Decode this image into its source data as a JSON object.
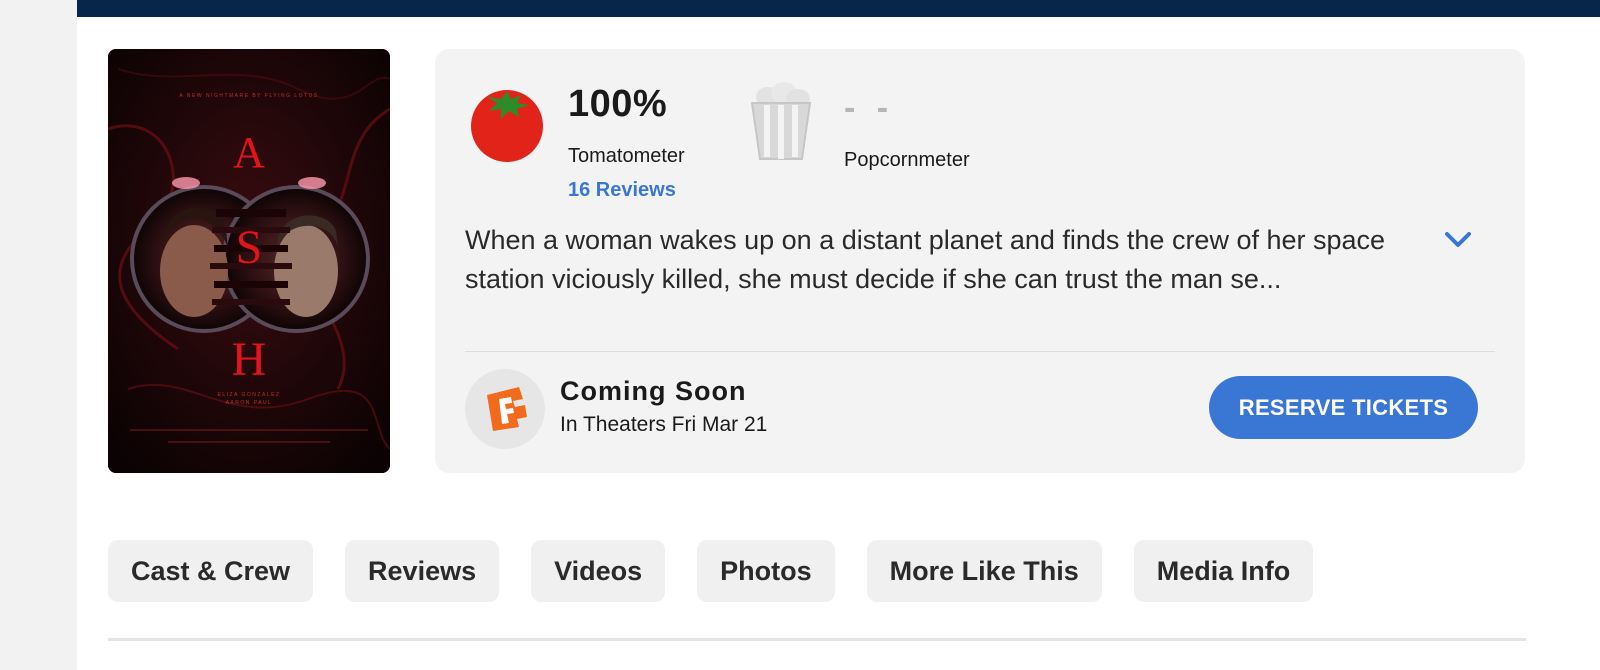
{
  "poster": {
    "title_letters": [
      "A",
      "S",
      "H"
    ],
    "credit_line": "A NEW NIGHTMARE BY FLYING LOTUS",
    "cast_line_1": "ELIZA GONZALEZ",
    "cast_line_2": "AARON PAUL"
  },
  "scores": {
    "tomatometer_value": "100%",
    "tomatometer_label": "Tomatometer",
    "reviews_link": "16 Reviews",
    "popcornmeter_value": "- -",
    "popcornmeter_label": "Popcornmeter"
  },
  "synopsis": "When a woman wakes up on a distant planet and finds the crew of her space station viciously killed, she must decide if she can trust the man se...",
  "release": {
    "title": "Coming Soon",
    "subtitle": "In Theaters Fri Mar 21",
    "button_label": "RESERVE TICKETS"
  },
  "tabs": [
    {
      "label": "Cast & Crew"
    },
    {
      "label": "Reviews"
    },
    {
      "label": "Videos"
    },
    {
      "label": "Photos"
    },
    {
      "label": "More Like This"
    },
    {
      "label": "Media Info"
    }
  ],
  "colors": {
    "nav_bar": "#07264a",
    "accent_blue": "#3a77d4",
    "tomato_red": "#e2231a",
    "fandango_orange": "#f26a1b"
  },
  "icons": [
    "tomato-icon",
    "popcorn-bucket-icon",
    "chevron-down-icon",
    "fandango-icon"
  ]
}
